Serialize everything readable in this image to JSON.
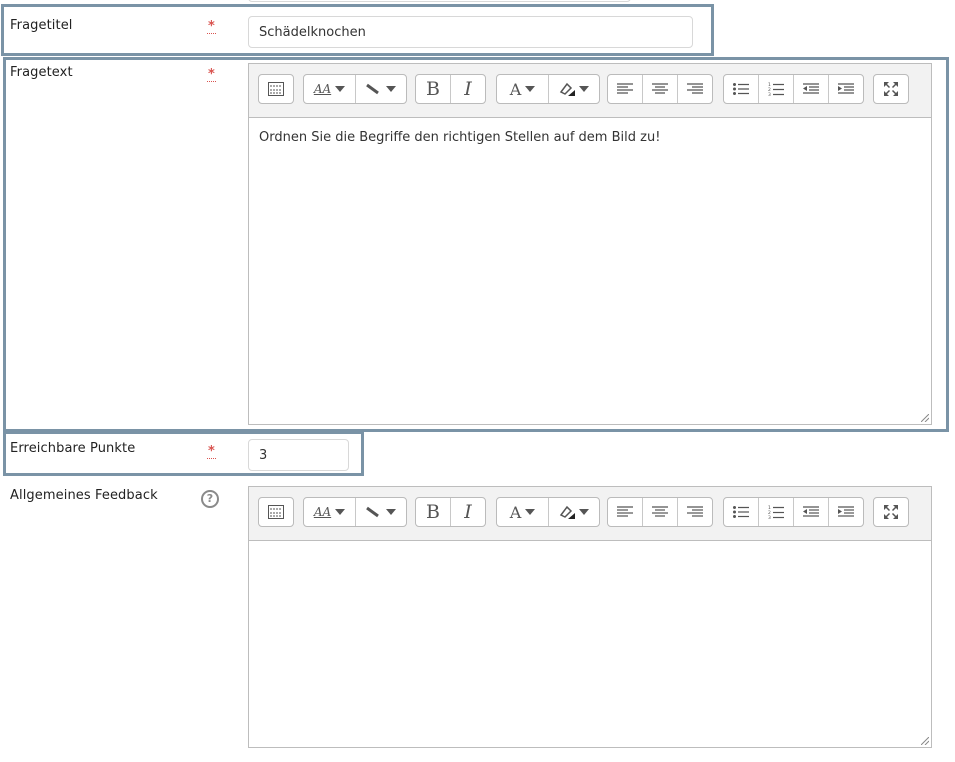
{
  "fields": {
    "title": {
      "label": "Fragetitel",
      "value": "Schädelknochen",
      "required_mark": "*"
    },
    "text": {
      "label": "Fragetext",
      "required_mark": "*",
      "content": "Ordnen Sie die Begriffe den richtigen Stellen auf dem Bild zu!"
    },
    "points": {
      "label": "Erreichbare Punkte",
      "value": "3",
      "required_mark": "*"
    },
    "feedback": {
      "label": "Allgemeines Feedback",
      "help": "?",
      "content": ""
    }
  },
  "toolbar": {
    "bold": "B",
    "italic": "I",
    "font_size": "AA",
    "font_color": "A"
  },
  "colors": {
    "highlight": "#7a93a6",
    "required": "#d9534f"
  },
  "icons": [
    "toolbar-toggle-icon",
    "font-size-icon",
    "paragraph-icon",
    "bold-icon",
    "italic-icon",
    "font-color-icon",
    "background-color-icon",
    "align-left-icon",
    "align-center-icon",
    "align-right-icon",
    "unordered-list-icon",
    "ordered-list-icon",
    "outdent-icon",
    "indent-icon",
    "fullscreen-icon"
  ]
}
